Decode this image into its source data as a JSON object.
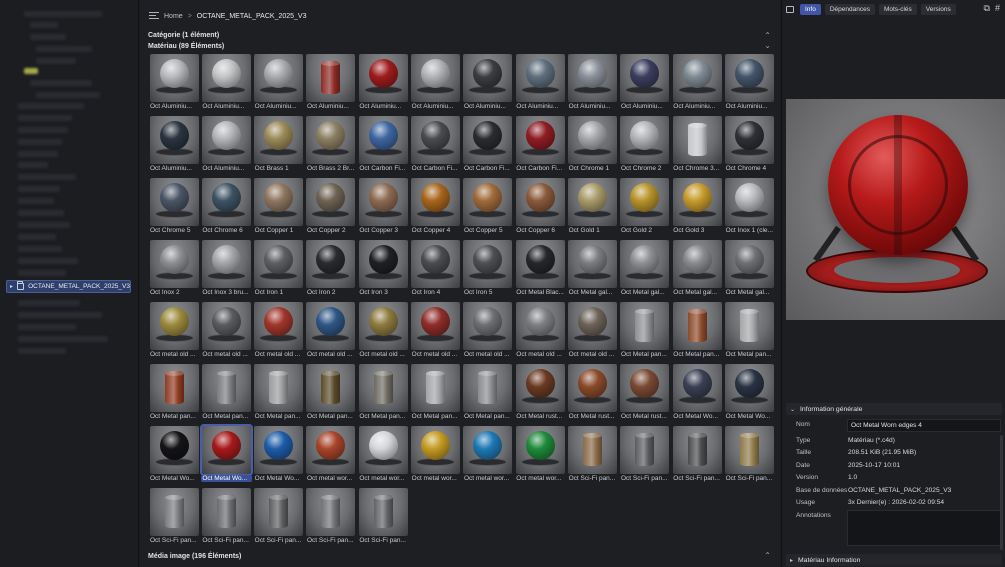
{
  "breadcrumb": {
    "home": "Home",
    "sep": ">",
    "current": "OCTANE_METAL_PACK_2025_V3"
  },
  "sidebar": {
    "selected": "OCTANE_METAL_PACK_2025_V3"
  },
  "sections": {
    "category": "Catégorie (1 élément)",
    "materials": "Matériau (89 Éléments)",
    "media": "Média image (196 Éléments)"
  },
  "materials": [
    {
      "name": "Oct Aluminiu...",
      "look": "sphere",
      "color": "#b8b9bc"
    },
    {
      "name": "Oct Aluminiu...",
      "look": "sphere",
      "color": "#c3c4c6"
    },
    {
      "name": "Oct Aluminiu...",
      "look": "sphere",
      "color": "#a9aaad"
    },
    {
      "name": "Oct Aluminiu...",
      "look": "can",
      "color": "#8c2a25"
    },
    {
      "name": "Oct Aluminiu...",
      "look": "sphere",
      "color": "#9e1c1c"
    },
    {
      "name": "Oct Aluminiu...",
      "look": "sphere",
      "color": "#b2b3b6"
    },
    {
      "name": "Oct Aluminiu...",
      "look": "sphere",
      "color": "#3c3d40"
    },
    {
      "name": "Oct Aluminiu...",
      "look": "sphere",
      "color": "#5f6e7e"
    },
    {
      "name": "Oct Aluminiu...",
      "look": "sphere",
      "color": "#8a9099"
    },
    {
      "name": "Oct Aluminiu...",
      "look": "sphere",
      "color": "#3a3e5e"
    },
    {
      "name": "Oct Aluminiu...",
      "look": "sphere",
      "color": "#7e8a93"
    },
    {
      "name": "Oct Aluminiu...",
      "look": "sphere",
      "color": "#44546a"
    },
    {
      "name": "Oct Aluminiu...",
      "look": "sphere",
      "color": "#2a3440"
    },
    {
      "name": "Oct Aluminiu...",
      "look": "sphere",
      "color": "#b5b6b9"
    },
    {
      "name": "Oct Brass 1",
      "look": "sphere",
      "color": "#9c8a58"
    },
    {
      "name": "Oct Brass 2 Br...",
      "look": "sphere",
      "color": "#8c7f62"
    },
    {
      "name": "Oct Carbon Fi...",
      "look": "sphere",
      "color": "#3e66a0"
    },
    {
      "name": "Oct Carbon Fi...",
      "look": "sphere",
      "color": "#4a4b4f"
    },
    {
      "name": "Oct Carbon Fi...",
      "look": "sphere",
      "color": "#2b2c2f"
    },
    {
      "name": "Oct Carbon Fi...",
      "look": "sphere",
      "color": "#8e1d24"
    },
    {
      "name": "Oct Chrome 1",
      "look": "sphere",
      "color": "#a6a7aa"
    },
    {
      "name": "Oct Chrome 2",
      "look": "sphere",
      "color": "#b4b5b8"
    },
    {
      "name": "Oct Chrome 3...",
      "look": "cylinder",
      "color": "#c5c6c9"
    },
    {
      "name": "Oct Chrome 4",
      "look": "sphere",
      "color": "#2e3036"
    },
    {
      "name": "Oct Chrome 5",
      "look": "sphere",
      "color": "#4a5566"
    },
    {
      "name": "Oct Chrome 6",
      "look": "sphere",
      "color": "#3d5263"
    },
    {
      "name": "Oct Copper 1",
      "look": "sphere",
      "color": "#8e7660"
    },
    {
      "name": "Oct Copper 2",
      "look": "sphere",
      "color": "#6e6254"
    },
    {
      "name": "Oct Copper 3",
      "look": "sphere",
      "color": "#8d6a52"
    },
    {
      "name": "Oct Copper 4",
      "look": "sphere",
      "color": "#a8651c"
    },
    {
      "name": "Oct Copper 5",
      "look": "sphere",
      "color": "#a06a3a"
    },
    {
      "name": "Oct Copper 6",
      "look": "sphere",
      "color": "#8a5a3a"
    },
    {
      "name": "Oct Gold 1",
      "look": "sphere",
      "color": "#a89a6a"
    },
    {
      "name": "Oct Gold 2",
      "look": "sphere",
      "color": "#b7932a"
    },
    {
      "name": "Oct Gold 3",
      "look": "sphere",
      "color": "#c69b2c"
    },
    {
      "name": "Oct Inox 1 (cle...",
      "look": "sphere",
      "color": "#b9babd"
    },
    {
      "name": "Oct Inox 2",
      "look": "sphere",
      "color": "#8d8e91"
    },
    {
      "name": "Oct Inox 3 bru...",
      "look": "sphere",
      "color": "#a5a6a9"
    },
    {
      "name": "Oct Iron 1",
      "look": "sphere",
      "color": "#5e5f62"
    },
    {
      "name": "Oct Iron 2",
      "look": "sphere",
      "color": "#2a2b2e"
    },
    {
      "name": "Oct Iron 3",
      "look": "sphere",
      "color": "#1f2023"
    },
    {
      "name": "Oct Iron 4",
      "look": "sphere",
      "color": "#4b4c4f"
    },
    {
      "name": "Oct Iron 5",
      "look": "sphere",
      "color": "#4e4f52"
    },
    {
      "name": "Oct Metal Blac...",
      "look": "sphere",
      "color": "#26272a"
    },
    {
      "name": "Oct Metal gal...",
      "look": "sphere",
      "color": "#7c7d80"
    },
    {
      "name": "Oct Metal gal...",
      "look": "sphere",
      "color": "#8f9093"
    },
    {
      "name": "Oct Metal gal...",
      "look": "sphere",
      "color": "#8a8b8e"
    },
    {
      "name": "Oct Metal gal...",
      "look": "sphere",
      "color": "#6f7073"
    },
    {
      "name": "Oct metal old ...",
      "look": "sphere",
      "color": "#9c8a3c"
    },
    {
      "name": "Oct metal old ...",
      "look": "sphere",
      "color": "#5a5b5e"
    },
    {
      "name": "Oct metal old ...",
      "look": "sphere",
      "color": "#a0362c"
    },
    {
      "name": "Oct metal old ...",
      "look": "sphere",
      "color": "#2f5684"
    },
    {
      "name": "Oct metal old ...",
      "look": "sphere",
      "color": "#8c7a3e"
    },
    {
      "name": "Oct metal old ...",
      "look": "sphere",
      "color": "#8e2d2a"
    },
    {
      "name": "Oct metal old ...",
      "look": "sphere",
      "color": "#6e6f72"
    },
    {
      "name": "Oct metal old ...",
      "look": "sphere",
      "color": "#7e7f82"
    },
    {
      "name": "Oct metal old ...",
      "look": "sphere",
      "color": "#6c6258"
    },
    {
      "name": "Oct Metal pan...",
      "look": "cylinder",
      "color": "#8e8f92"
    },
    {
      "name": "Oct Metal pan...",
      "look": "cylinder",
      "color": "#8c4a2a"
    },
    {
      "name": "Oct Metal pan...",
      "look": "cylinder",
      "color": "#a5a6a9"
    },
    {
      "name": "Oct Metal pan...",
      "look": "cylinder",
      "color": "#8e3a22"
    },
    {
      "name": "Oct Metal pan...",
      "look": "cylinder",
      "color": "#7a7b7e"
    },
    {
      "name": "Oct Metal pan...",
      "look": "cylinder",
      "color": "#9a9b9e"
    },
    {
      "name": "Oct Metal pan...",
      "look": "cylinder",
      "color": "#5a4a2a"
    },
    {
      "name": "Oct Metal pan...",
      "look": "cylinder",
      "color": "#6e6a62"
    },
    {
      "name": "Oct Metal pan...",
      "look": "cylinder",
      "color": "#a3a4a7"
    },
    {
      "name": "Oct Metal pan...",
      "look": "cylinder",
      "color": "#8a8b8e"
    },
    {
      "name": "Oct Metal rust...",
      "look": "sphere",
      "color": "#6a3a22"
    },
    {
      "name": "Oct Metal rust...",
      "look": "sphere",
      "color": "#8a4a2a"
    },
    {
      "name": "Oct Metal rust...",
      "look": "sphere",
      "color": "#7a4a34"
    },
    {
      "name": "Oct Metal Wo...",
      "look": "sphere",
      "color": "#3a4054"
    },
    {
      "name": "Oct Metal Wo...",
      "look": "sphere",
      "color": "#2a3344"
    },
    {
      "name": "Oct Metal Wo...",
      "look": "sphere",
      "color": "#141416"
    },
    {
      "name": "Oct Metal Wo...",
      "look": "sphere",
      "color": "#a51a1a",
      "selected": true
    },
    {
      "name": "Oct Metal Wo...",
      "look": "sphere",
      "color": "#1e5ca8"
    },
    {
      "name": "Oct metal wor...",
      "look": "sphere",
      "color": "#a8442a"
    },
    {
      "name": "Oct metal wor...",
      "look": "sphere",
      "color": "#d5d6d9"
    },
    {
      "name": "Oct metal wor...",
      "look": "sphere",
      "color": "#c49a22"
    },
    {
      "name": "Oct metal wor...",
      "look": "sphere",
      "color": "#1e78b4"
    },
    {
      "name": "Oct metal wor...",
      "look": "sphere",
      "color": "#1e8a3a"
    },
    {
      "name": "Oct Sci-Fi pan...",
      "look": "cylinder",
      "color": "#8a6a4a"
    },
    {
      "name": "Oct Sci-Fi pan...",
      "look": "cylinder",
      "color": "#5a5b5e"
    },
    {
      "name": "Oct Sci-Fi pan...",
      "look": "cylinder",
      "color": "#4a4b4e"
    },
    {
      "name": "Oct Sci-Fi pan...",
      "look": "cylinder",
      "color": "#8e7a4a"
    },
    {
      "name": "Oct Sci-Fi pan...",
      "look": "cylinder",
      "color": "#7a7b7e"
    },
    {
      "name": "Oct Sci-Fi pan...",
      "look": "cylinder",
      "color": "#6a6b6e"
    },
    {
      "name": "Oct Sci-Fi pan...",
      "look": "cylinder",
      "color": "#5c5d60"
    },
    {
      "name": "Oct Sci-Fi pan...",
      "look": "cylinder",
      "color": "#707174"
    },
    {
      "name": "Oct Sci-Fi pan...",
      "look": "cylinder",
      "color": "#626366"
    }
  ],
  "right_panel": {
    "tabs": [
      "Info",
      "Dépendances",
      "Mots-clés",
      "Versions"
    ],
    "active_tab": "Info",
    "info_header": "Information générale",
    "fields": {
      "name_label": "Nom",
      "name_value": "Oct Metal Worn edges 4",
      "type_label": "Type",
      "type_value": "Matériau (*.c4d)",
      "size_label": "Taille",
      "size_value": "208.51 KiB (21.95 MiB)",
      "date_label": "Date",
      "date_value": "2025-10-17 10:01",
      "version_label": "Version",
      "version_value": "1.0",
      "db_label": "Base de données",
      "db_value": "OCTANE_METAL_PACK_2025_V3",
      "usage_label": "Usage",
      "usage_value": "3x Dernier(e) : 2026-02-02 09:54",
      "annotations_label": "Annotations"
    },
    "material_info_header": "Matériau Information"
  },
  "icons": {
    "menu": "hamburger-icon",
    "image": "image-icon",
    "copy": "copy-icon",
    "hash": "hash-icon",
    "collapse": "chevron-up-icon",
    "expand": "chevron-down-icon"
  }
}
